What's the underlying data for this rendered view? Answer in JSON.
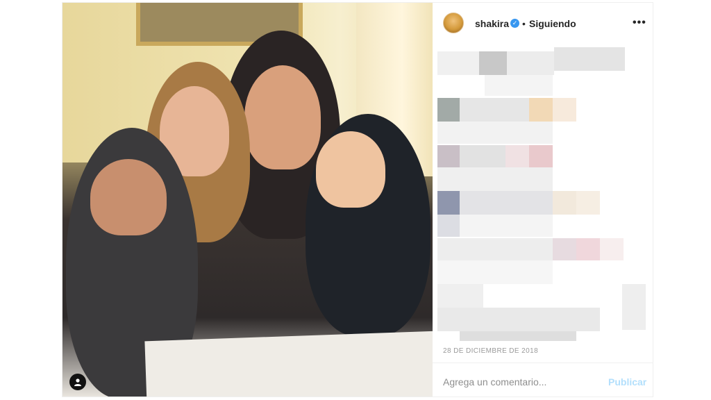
{
  "post": {
    "author": {
      "username": "shakira",
      "verified_icon": "verified-badge-icon",
      "separator": "•",
      "follow_status": "Siguiendo"
    },
    "more_options": "•••",
    "date": "28 DE DICIEMBRE DE 2018",
    "comment_placeholder": "Agrega un comentario...",
    "publish_label": "Publicar",
    "photo_icon": "user-tag-icon"
  },
  "colors": {
    "accent_blue": "#3897f0",
    "publish_disabled": "#b2dffc",
    "meta_gray": "#999999",
    "border": "#efefef"
  }
}
